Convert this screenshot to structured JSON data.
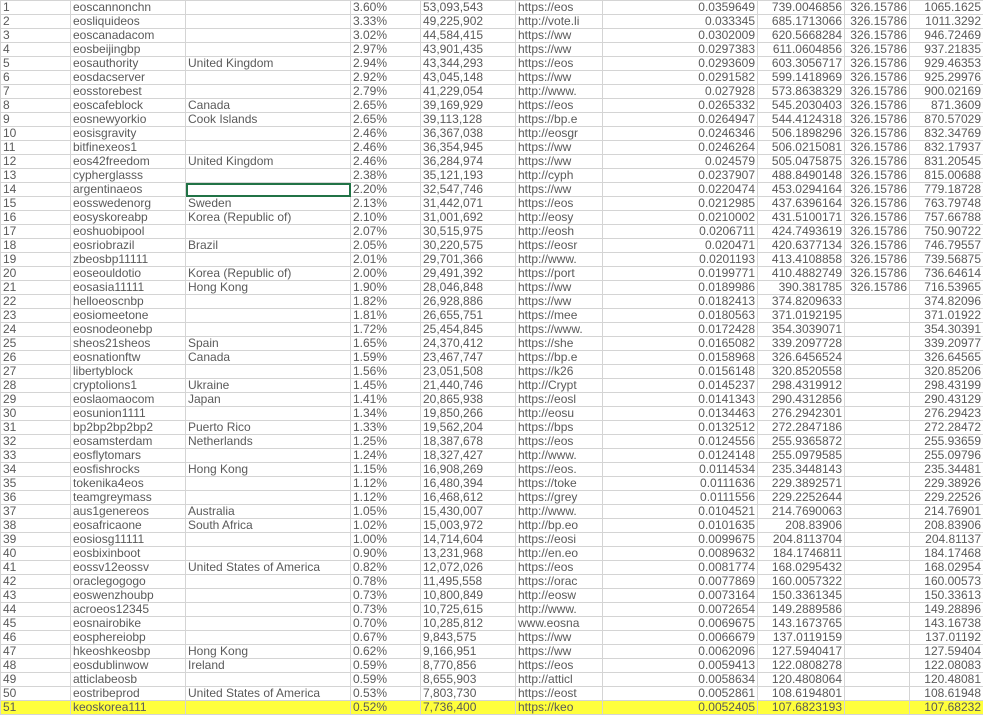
{
  "highlight_color": "#ffff3c",
  "rows": [
    [
      "1",
      "eoscannonchn",
      "",
      "3.60%",
      "53,093,543",
      "https://eos",
      "0.0359649",
      "739.0046856",
      "326.15786",
      "1065.1625"
    ],
    [
      "2",
      "eosliquideos",
      "",
      "3.33%",
      "49,225,902",
      "http://vote.li",
      "0.033345",
      "685.1713066",
      "326.15786",
      "1011.3292"
    ],
    [
      "3",
      "eoscanadacom",
      "",
      "3.02%",
      "44,584,415",
      "https://ww",
      "0.0302009",
      "620.5668284",
      "326.15786",
      "946.72469"
    ],
    [
      "4",
      "eosbeijingbp",
      "",
      "2.97%",
      "43,901,435",
      "https://ww",
      "0.0297383",
      "611.0604856",
      "326.15786",
      "937.21835"
    ],
    [
      "5",
      "eosauthority",
      "United Kingdom",
      "2.94%",
      "43,344,293",
      "https://eos",
      "0.0293609",
      "603.3056717",
      "326.15786",
      "929.46353"
    ],
    [
      "6",
      "eosdacserver",
      "",
      "2.92%",
      "43,045,148",
      "https://ww",
      "0.0291582",
      "599.1418969",
      "326.15786",
      "925.29976"
    ],
    [
      "7",
      "eosstorebest",
      "",
      "2.79%",
      "41,229,054",
      "http://www.",
      "0.027928",
      "573.8638329",
      "326.15786",
      "900.02169"
    ],
    [
      "8",
      "eoscafeblock",
      "Canada",
      "2.65%",
      "39,169,929",
      "https://eos",
      "0.0265332",
      "545.2030403",
      "326.15786",
      "871.3609"
    ],
    [
      "9",
      "eosnewyorkio",
      "Cook Islands",
      "2.65%",
      "39,113,128",
      "https://bp.e",
      "0.0264947",
      "544.4124318",
      "326.15786",
      "870.57029"
    ],
    [
      "10",
      "eosisgravity",
      "",
      "2.46%",
      "36,367,038",
      "http://eosgr",
      "0.0246346",
      "506.1898296",
      "326.15786",
      "832.34769"
    ],
    [
      "11",
      "bitfinexeos1",
      "",
      "2.46%",
      "36,354,945",
      "https://ww",
      "0.0246264",
      "506.0215081",
      "326.15786",
      "832.17937"
    ],
    [
      "12",
      "eos42freedom",
      "United Kingdom",
      "2.46%",
      "36,284,974",
      "https://ww",
      "0.024579",
      "505.0475875",
      "326.15786",
      "831.20545"
    ],
    [
      "13",
      "cypherglasss",
      "",
      "2.38%",
      "35,121,193",
      "http://cyph",
      "0.0237907",
      "488.8490148",
      "326.15786",
      "815.00688"
    ],
    [
      "14",
      "argentinaeos",
      "",
      "2.20%",
      "32,547,746",
      "https://ww",
      "0.0220474",
      "453.0294164",
      "326.15786",
      "779.18728"
    ],
    [
      "15",
      "eosswedenorg",
      "Sweden",
      "2.13%",
      "31,442,071",
      "https://eos",
      "0.0212985",
      "437.6396164",
      "326.15786",
      "763.79748"
    ],
    [
      "16",
      "eosyskoreabp",
      "Korea (Republic of)",
      "2.10%",
      "31,001,692",
      "http://eosy",
      "0.0210002",
      "431.5100171",
      "326.15786",
      "757.66788"
    ],
    [
      "17",
      "eoshuobipool",
      "",
      "2.07%",
      "30,515,975",
      "http://eosh",
      "0.0206711",
      "424.7493619",
      "326.15786",
      "750.90722"
    ],
    [
      "18",
      "eosriobrazil",
      "Brazil",
      "2.05%",
      "30,220,575",
      "https://eosr",
      "0.020471",
      "420.6377134",
      "326.15786",
      "746.79557"
    ],
    [
      "19",
      "zbeosbp11111",
      "",
      "2.01%",
      "29,701,366",
      "http://www.",
      "0.0201193",
      "413.4108858",
      "326.15786",
      "739.56875"
    ],
    [
      "20",
      "eoseouldotio",
      "Korea (Republic of)",
      "2.00%",
      "29,491,392",
      "https://port",
      "0.0199771",
      "410.4882749",
      "326.15786",
      "736.64614"
    ],
    [
      "21",
      "eosasia11111",
      "Hong Kong",
      "1.90%",
      "28,046,848",
      "https://ww",
      "0.0189986",
      "390.381785",
      "326.15786",
      "716.53965"
    ],
    [
      "22",
      "helloeoscnbp",
      "",
      "1.82%",
      "26,928,886",
      "https://ww",
      "0.0182413",
      "374.8209633",
      "",
      "374.82096"
    ],
    [
      "23",
      "eosiomeetone",
      "",
      "1.81%",
      "26,655,751",
      "https://mee",
      "0.0180563",
      "371.0192195",
      "",
      "371.01922"
    ],
    [
      "24",
      "eosnodeonebp",
      "",
      "1.72%",
      "25,454,845",
      "https://www.",
      "0.0172428",
      "354.3039071",
      "",
      "354.30391"
    ],
    [
      "25",
      "sheos21sheos",
      "Spain",
      "1.65%",
      "24,370,412",
      "https://she",
      "0.0165082",
      "339.2097728",
      "",
      "339.20977"
    ],
    [
      "26",
      "eosnationftw",
      "Canada",
      "1.59%",
      "23,467,747",
      "https://bp.e",
      "0.0158968",
      "326.6456524",
      "",
      "326.64565"
    ],
    [
      "27",
      "libertyblock",
      "",
      "1.56%",
      "23,051,508",
      "https://k26",
      "0.0156148",
      "320.8520558",
      "",
      "320.85206"
    ],
    [
      "28",
      "cryptolions1",
      "Ukraine",
      "1.45%",
      "21,440,746",
      "http://Crypt",
      "0.0145237",
      "298.4319912",
      "",
      "298.43199"
    ],
    [
      "29",
      "eoslaomaocom",
      "Japan",
      "1.41%",
      "20,865,938",
      "https://eosl",
      "0.0141343",
      "290.4312856",
      "",
      "290.43129"
    ],
    [
      "30",
      "eosunion1111",
      "",
      "1.34%",
      "19,850,266",
      "http://eosu",
      "0.0134463",
      "276.2942301",
      "",
      "276.29423"
    ],
    [
      "31",
      "bp2bp2bp2bp2",
      "Puerto Rico",
      "1.33%",
      "19,562,204",
      "https://bps",
      "0.0132512",
      "272.2847186",
      "",
      "272.28472"
    ],
    [
      "32",
      "eosamsterdam",
      "Netherlands",
      "1.25%",
      "18,387,678",
      "https://eos",
      "0.0124556",
      "255.9365872",
      "",
      "255.93659"
    ],
    [
      "33",
      "eosflytomars",
      "",
      "1.24%",
      "18,327,427",
      "http://www.",
      "0.0124148",
      "255.0979585",
      "",
      "255.09796"
    ],
    [
      "34",
      "eosfishrocks",
      "Hong Kong",
      "1.15%",
      "16,908,269",
      "https://eos.",
      "0.0114534",
      "235.3448143",
      "",
      "235.34481"
    ],
    [
      "35",
      "tokenika4eos",
      "",
      "1.12%",
      "16,480,394",
      "https://toke",
      "0.0111636",
      "229.3892571",
      "",
      "229.38926"
    ],
    [
      "36",
      "teamgreymass",
      "",
      "1.12%",
      "16,468,612",
      "https://grey",
      "0.0111556",
      "229.2252644",
      "",
      "229.22526"
    ],
    [
      "37",
      "aus1genereos",
      "Australia",
      "1.05%",
      "15,430,007",
      "http://www.",
      "0.0104521",
      "214.7690063",
      "",
      "214.76901"
    ],
    [
      "38",
      "eosafricaone",
      "South Africa",
      "1.02%",
      "15,003,972",
      "http://bp.eo",
      "0.0101635",
      "208.83906",
      "",
      "208.83906"
    ],
    [
      "39",
      "eosiosg11111",
      "",
      "1.00%",
      "14,714,604",
      "https://eosi",
      "0.0099675",
      "204.8113704",
      "",
      "204.81137"
    ],
    [
      "40",
      "eosbixinboot",
      "",
      "0.90%",
      "13,231,968",
      "http://en.eo",
      "0.0089632",
      "184.1746811",
      "",
      "184.17468"
    ],
    [
      "41",
      "eossv12eossv",
      "United States of America",
      "0.82%",
      "12,072,026",
      "https://eos",
      "0.0081774",
      "168.0295432",
      "",
      "168.02954"
    ],
    [
      "42",
      "oraclegogogo",
      "",
      "0.78%",
      "11,495,558",
      "https://orac",
      "0.0077869",
      "160.0057322",
      "",
      "160.00573"
    ],
    [
      "43",
      "eoswenzhoubp",
      "",
      "0.73%",
      "10,800,849",
      "http://eosw",
      "0.0073164",
      "150.3361345",
      "",
      "150.33613"
    ],
    [
      "44",
      "acroeos12345",
      "",
      "0.73%",
      "10,725,615",
      "http://www.",
      "0.0072654",
      "149.2889586",
      "",
      "149.28896"
    ],
    [
      "45",
      "eosnairobike",
      "",
      "0.70%",
      "10,285,812",
      "www.eosna",
      "0.0069675",
      "143.1673765",
      "",
      "143.16738"
    ],
    [
      "46",
      "eosphereiobp",
      "",
      "0.67%",
      "9,843,575",
      "https://ww",
      "0.0066679",
      "137.0119159",
      "",
      "137.01192"
    ],
    [
      "47",
      "hkeoshkeosbp",
      "Hong Kong",
      "0.62%",
      "9,166,951",
      "https://ww",
      "0.0062096",
      "127.5940417",
      "",
      "127.59404"
    ],
    [
      "48",
      "eosdublinwow",
      "Ireland",
      "0.59%",
      "8,770,856",
      "https://eos",
      "0.0059413",
      "122.0808278",
      "",
      "122.08083"
    ],
    [
      "49",
      "atticlabeosb",
      "",
      "0.59%",
      "8,655,903",
      "http://atticl",
      "0.0058634",
      "120.4808064",
      "",
      "120.48081"
    ],
    [
      "50",
      "eostribeprod",
      "United States of America",
      "0.53%",
      "7,803,730",
      "https://eost",
      "0.0052861",
      "108.6194801",
      "",
      "108.61948"
    ],
    [
      "51",
      "keoskorea111",
      "",
      "0.52%",
      "7,736,400",
      "https://keo",
      "0.0052405",
      "107.6823193",
      "",
      "107.68232"
    ]
  ]
}
